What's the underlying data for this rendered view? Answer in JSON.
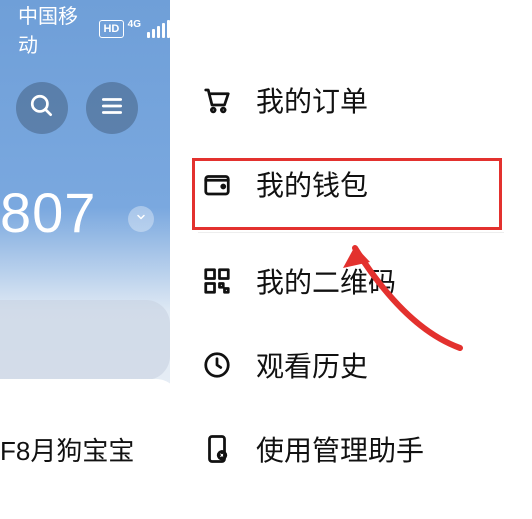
{
  "status_bar": {
    "carrier": "中国移动",
    "hd_badge": "HD",
    "network_type": "4G"
  },
  "left_panel": {
    "number_fragment": "807",
    "card_text_fragment": "F8月狗宝宝"
  },
  "drawer_menu": {
    "items": [
      {
        "key": "orders",
        "label": "我的订单",
        "icon": "cart-icon"
      },
      {
        "key": "wallet",
        "label": "我的钱包",
        "icon": "wallet-icon",
        "highlighted": true
      },
      {
        "key": "qrcode",
        "label": "我的二维码",
        "icon": "qrcode-icon"
      },
      {
        "key": "history",
        "label": "观看历史",
        "icon": "clock-icon"
      },
      {
        "key": "manage",
        "label": "使用管理助手",
        "icon": "phone-settings-icon"
      }
    ]
  },
  "annotation": {
    "highlight_target": "wallet",
    "highlight_color": "#e3312e"
  }
}
